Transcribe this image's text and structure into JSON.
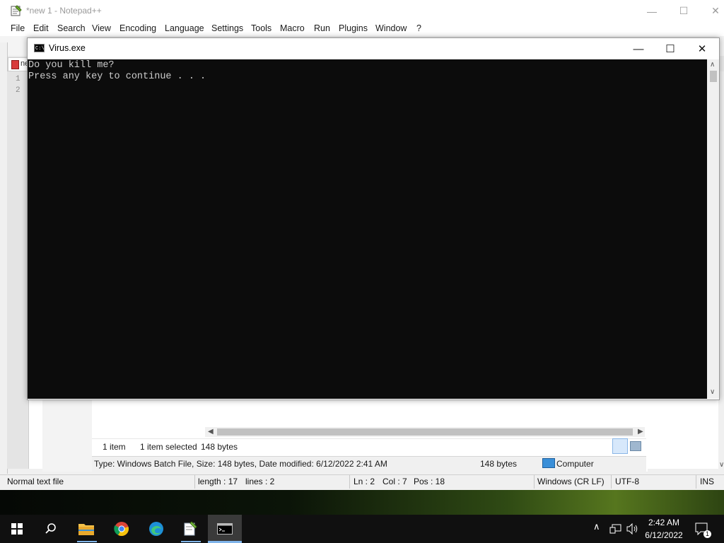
{
  "notepad": {
    "title": "*new 1 - Notepad++",
    "menu": [
      "File",
      "Edit",
      "Search",
      "View",
      "Encoding",
      "Language",
      "Settings",
      "Tools",
      "Macro",
      "Run",
      "Plugins",
      "Window",
      "?"
    ],
    "tab_label": "ne",
    "line_numbers": [
      "1",
      "2"
    ],
    "status": {
      "file_type": "Normal text file",
      "length": "length : 17",
      "lines": "lines : 2",
      "ln": "Ln : 2",
      "col": "Col : 7",
      "pos": "Pos : 18",
      "eol": "Windows (CR LF)",
      "encoding": "UTF-8",
      "mode": "INS"
    }
  },
  "explorer": {
    "item_count": "1 item",
    "selected": "1 item selected",
    "selected_size": "148 bytes",
    "details": "Type: Windows Batch File, Size: 148 bytes, Date modified: 6/12/2022 2:41 AM",
    "details_size": "148 bytes",
    "location": "Computer"
  },
  "console": {
    "title": "Virus.exe",
    "lines": [
      "Do you kill me?",
      "Press any key to continue . . ."
    ]
  },
  "taskbar": {
    "time": "2:42 AM",
    "date": "6/12/2022",
    "notification_count": "1",
    "accent": "#7fb4ea"
  }
}
